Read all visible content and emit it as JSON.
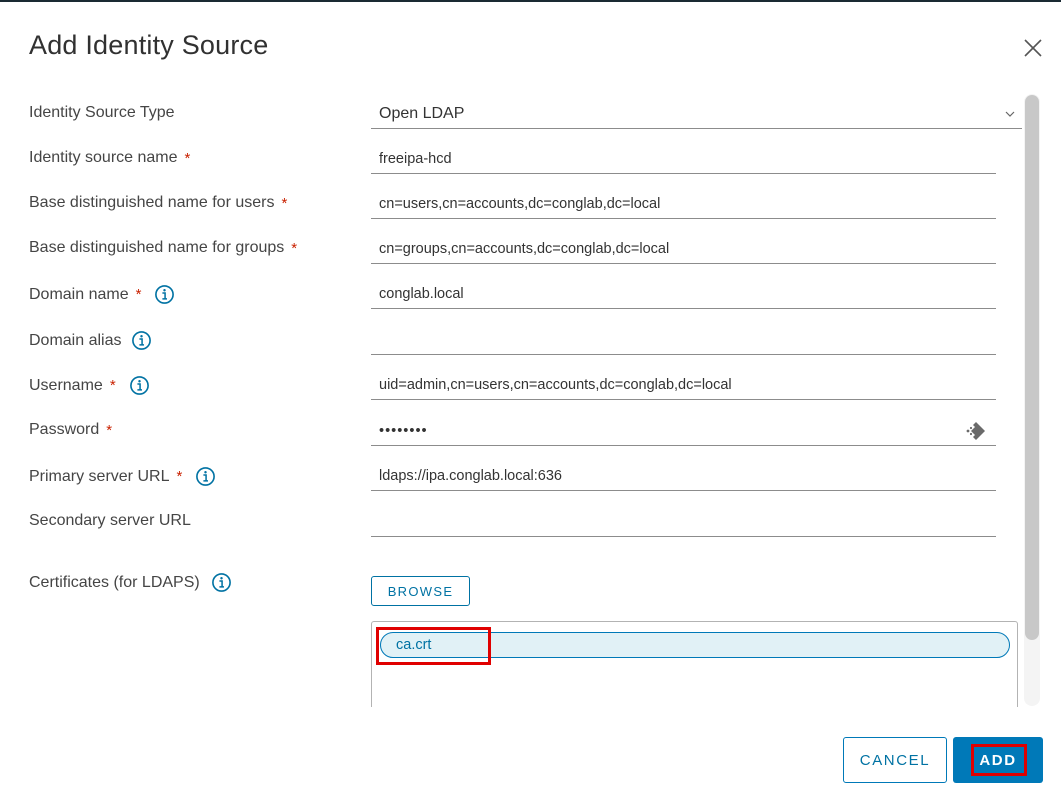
{
  "dialog": {
    "title": "Add Identity Source",
    "close_icon": "close-icon"
  },
  "form": {
    "identity_source_type": {
      "label": "Identity Source Type",
      "value": "Open LDAP"
    },
    "identity_source_name": {
      "label": "Identity source name",
      "required": "*",
      "value": "freeipa-hcd"
    },
    "base_dn_users": {
      "label": "Base distinguished name for users",
      "required": "*",
      "value": "cn=users,cn=accounts,dc=conglab,dc=local"
    },
    "base_dn_groups": {
      "label": "Base distinguished name for groups",
      "required": "*",
      "value": "cn=groups,cn=accounts,dc=conglab,dc=local"
    },
    "domain_name": {
      "label": "Domain name",
      "required": "*",
      "value": "conglab.local"
    },
    "domain_alias": {
      "label": "Domain alias",
      "value": ""
    },
    "username": {
      "label": "Username",
      "required": "*",
      "value": "uid=admin,cn=users,cn=accounts,dc=conglab,dc=local"
    },
    "password": {
      "label": "Password",
      "required": "*",
      "value": "••••••••"
    },
    "primary_url": {
      "label": "Primary server URL",
      "required": "*",
      "value": "ldaps://ipa.conglab.local:636"
    },
    "secondary_url": {
      "label": "Secondary server URL",
      "value": ""
    },
    "certificates": {
      "label": "Certificates (for LDAPS)",
      "browse_label": "BROWSE",
      "files": [
        "ca.crt"
      ]
    }
  },
  "footer": {
    "cancel_label": "CANCEL",
    "add_label": "ADD"
  },
  "colors": {
    "accent": "#0079b8",
    "required": "#c92100",
    "highlight": "#e00000",
    "chip_bg": "#e1f1f6"
  }
}
